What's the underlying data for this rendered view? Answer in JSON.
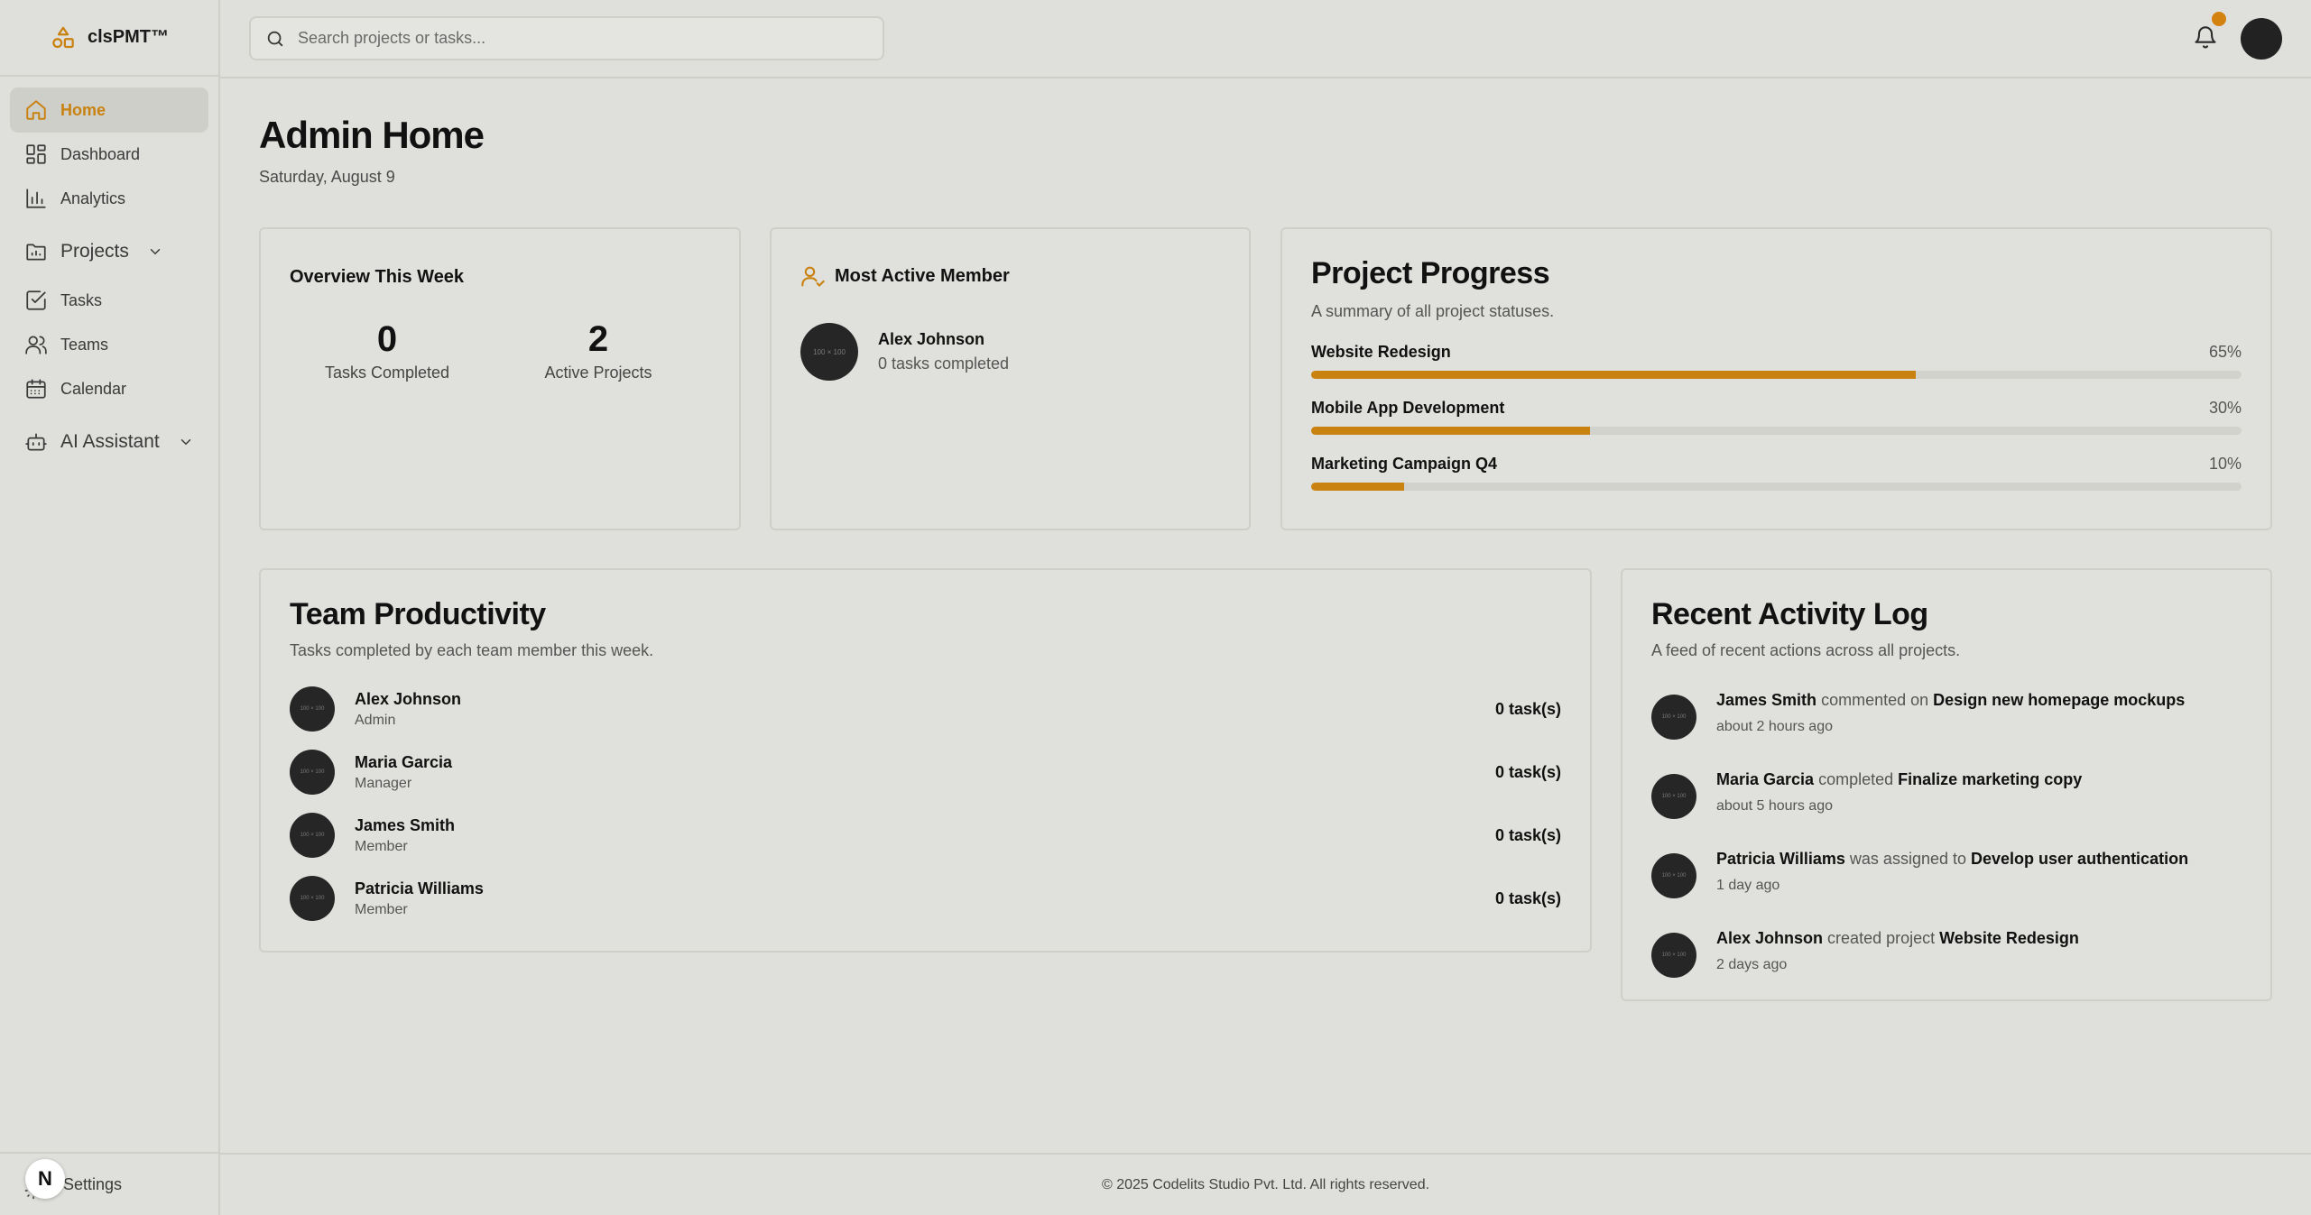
{
  "brand": {
    "name": "clsPMT™"
  },
  "sidebar": {
    "items": [
      {
        "label": "Home",
        "icon": "home-icon",
        "active": true
      },
      {
        "label": "Dashboard",
        "icon": "dashboard-icon"
      },
      {
        "label": "Analytics",
        "icon": "analytics-icon"
      },
      {
        "label": "Projects",
        "icon": "folder-icon",
        "group": true
      },
      {
        "label": "Tasks",
        "icon": "task-check-icon"
      },
      {
        "label": "Teams",
        "icon": "users-icon"
      },
      {
        "label": "Calendar",
        "icon": "calendar-icon"
      },
      {
        "label": "AI Assistant",
        "icon": "bot-icon",
        "group": true
      }
    ],
    "settings_label": "Settings",
    "n_badge": "N"
  },
  "header": {
    "search_placeholder": "Search projects or tasks..."
  },
  "page": {
    "title": "Admin Home",
    "date": "Saturday, August 9"
  },
  "overview": {
    "title": "Overview This Week",
    "tasks_completed": {
      "value": "0",
      "label": "Tasks Completed"
    },
    "active_projects": {
      "value": "2",
      "label": "Active Projects"
    }
  },
  "most_active": {
    "title": "Most Active Member",
    "name": "Alex Johnson",
    "meta": "0 tasks completed",
    "avatar_text": "100 × 100"
  },
  "project_progress": {
    "title": "Project Progress",
    "subtitle": "A summary of all project statuses.",
    "projects": [
      {
        "name": "Website Redesign",
        "percent_label": "65%",
        "progress": 0.65
      },
      {
        "name": "Mobile App Development",
        "percent_label": "30%",
        "progress": 0.3
      },
      {
        "name": "Marketing Campaign Q4",
        "percent_label": "10%",
        "progress": 0.1
      }
    ]
  },
  "team_productivity": {
    "title": "Team Productivity",
    "subtitle": "Tasks completed by each team member this week.",
    "members": [
      {
        "name": "Alex Johnson",
        "role": "Admin",
        "count": "0 task(s)"
      },
      {
        "name": "Maria Garcia",
        "role": "Manager",
        "count": "0 task(s)"
      },
      {
        "name": "James Smith",
        "role": "Member",
        "count": "0 task(s)"
      },
      {
        "name": "Patricia Williams",
        "role": "Member",
        "count": "0 task(s)"
      }
    ]
  },
  "activity": {
    "title": "Recent Activity Log",
    "subtitle": "A feed of recent actions across all projects.",
    "entries": [
      {
        "actor": "James Smith",
        "action": "commented on",
        "target": "Design new homepage mockups",
        "when": "about 2 hours ago"
      },
      {
        "actor": "Maria Garcia",
        "action": "completed",
        "target": "Finalize marketing copy",
        "when": "about 5 hours ago"
      },
      {
        "actor": "Patricia Williams",
        "action": "was assigned to",
        "target": "Develop user authentication",
        "when": "1 day ago"
      },
      {
        "actor": "Alex Johnson",
        "action": "created project",
        "target": "Website Redesign",
        "when": "2 days ago"
      }
    ]
  },
  "footer": {
    "text": "© 2025 Codelits Studio Pvt. Ltd. All rights reserved."
  },
  "colors": {
    "accent": "#c9820f",
    "background": "#dfdfdb",
    "border": "#cfcfca"
  }
}
